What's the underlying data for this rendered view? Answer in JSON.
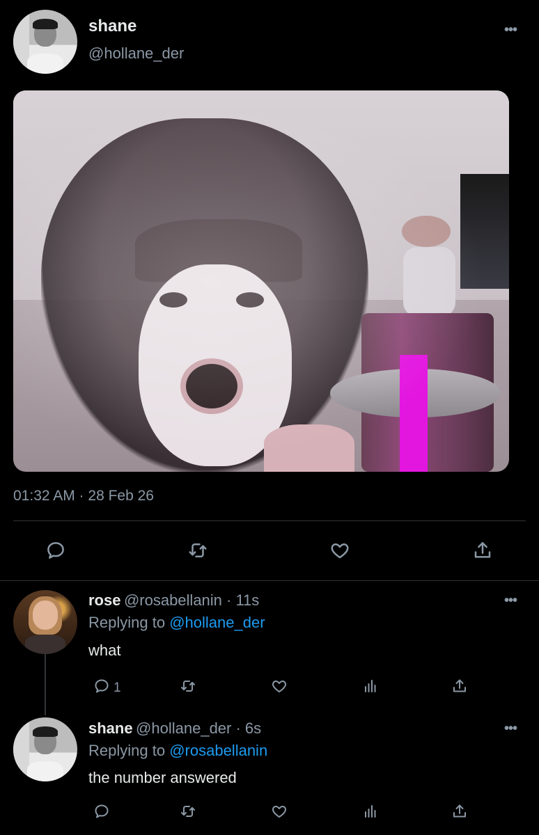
{
  "main_tweet": {
    "name": "shane",
    "handle": "@hollane_der",
    "more_label": "•••",
    "timestamp": "01:32 AM · 28 Feb 26"
  },
  "replies": [
    {
      "name": "rose",
      "handle_time": "@rosabellanin · 11s",
      "replying_prefix": "Replying to",
      "replying_to": "@hollane_der",
      "text": "what",
      "reply_count": "1",
      "more_label": "•••"
    },
    {
      "name": "shane",
      "handle_time": "@hollane_der · 6s",
      "replying_prefix": "Replying to",
      "replying_to": "@rosabellanin",
      "text": "the number answered",
      "reply_count": "",
      "more_label": "•••"
    }
  ],
  "icons": {
    "reply": "reply-icon",
    "retweet": "retweet-icon",
    "like": "heart-icon",
    "share": "share-icon",
    "analytics": "analytics-icon"
  },
  "colors": {
    "background": "#000000",
    "text": "#e7e9ea",
    "secondary": "#8b98a5",
    "mention": "#1d9bf0",
    "divider": "#2f3336"
  }
}
